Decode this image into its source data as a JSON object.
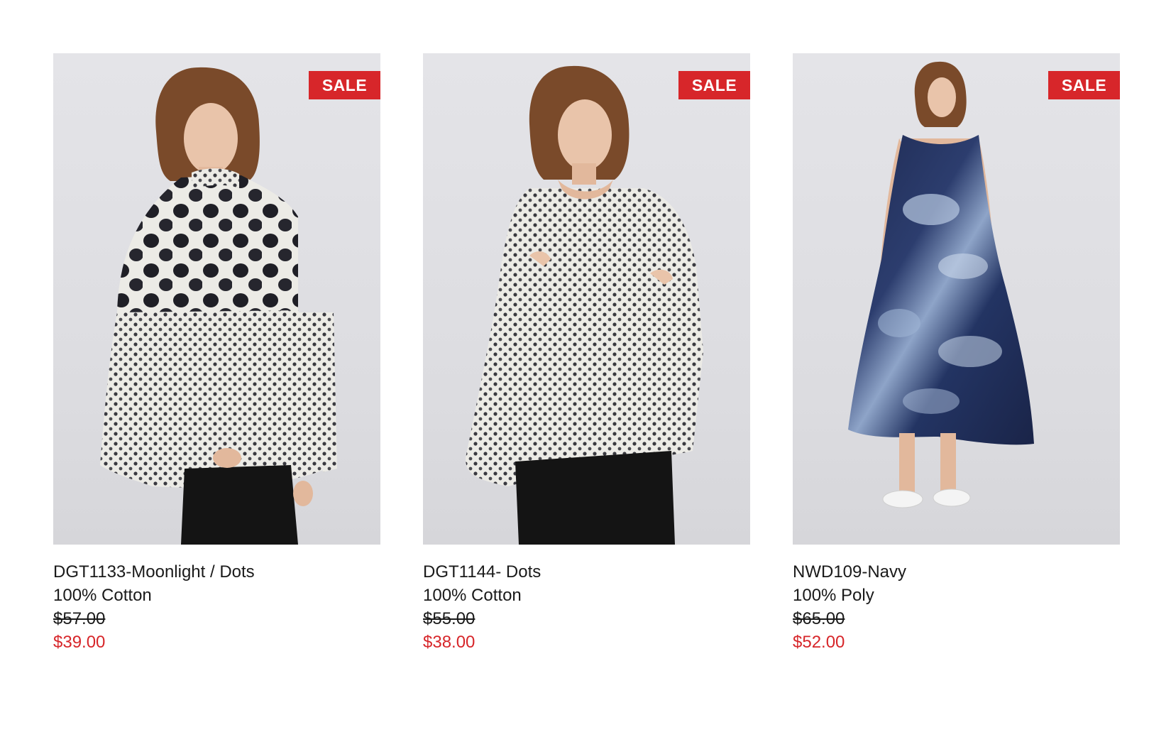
{
  "colors": {
    "sale_badge": "#d7262a",
    "sale_price": "#d7262a",
    "text": "#1a1a1a"
  },
  "products": [
    {
      "badge": "SALE",
      "name": "DGT1133-Moonlight / Dots",
      "material": "100% Cotton",
      "original_price": "$57.00",
      "sale_price": "$39.00"
    },
    {
      "badge": "SALE",
      "name": "DGT1144- Dots",
      "material": "100% Cotton",
      "original_price": "$55.00",
      "sale_price": "$38.00"
    },
    {
      "badge": "SALE",
      "name": "NWD109-Navy",
      "material": "100% Poly",
      "original_price": "$65.00",
      "sale_price": "$52.00"
    }
  ]
}
